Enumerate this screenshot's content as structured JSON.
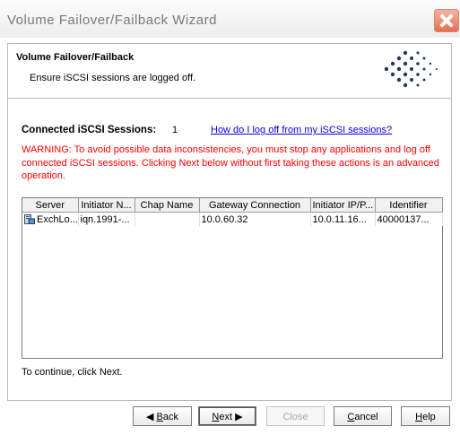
{
  "window": {
    "title": "Volume Failover/Failback Wizard",
    "close_icon": "close-icon"
  },
  "header": {
    "title": "Volume Failover/Failback",
    "subtitle": "Ensure iSCSI sessions are logged off."
  },
  "sessions": {
    "label": "Connected iSCSI Sessions:",
    "count": "1",
    "help_link": "How do I log off from my iSCSI sessions?"
  },
  "warning": "WARNING: To avoid possible data inconsistencies, you must stop any applications and log off connected iSCSI sessions. Clicking Next below without first taking these actions is an advanced operation.",
  "table": {
    "columns": [
      "Server",
      "Initiator N...",
      "Chap Name",
      "Gateway Connection",
      "Initiator IP/P...",
      "Identifier"
    ],
    "rows": [
      [
        "ExchLo...",
        "iqn.1991-...",
        "",
        "10.0.60.32",
        "10.0.11.16...",
        "40000137..."
      ]
    ]
  },
  "footer_text": "To continue, click Next.",
  "buttons": {
    "back": {
      "mnemonic": "B",
      "rest": "ack"
    },
    "next": {
      "mnemonic": "N",
      "rest": "ext"
    },
    "close": "Close",
    "cancel": {
      "mnemonic": "C",
      "rest": "ancel"
    },
    "help": {
      "mnemonic": "H",
      "rest": "elp"
    }
  },
  "colors": {
    "warning": "#ff0000",
    "link": "#0000ff",
    "logo": "#1e3a5a"
  }
}
